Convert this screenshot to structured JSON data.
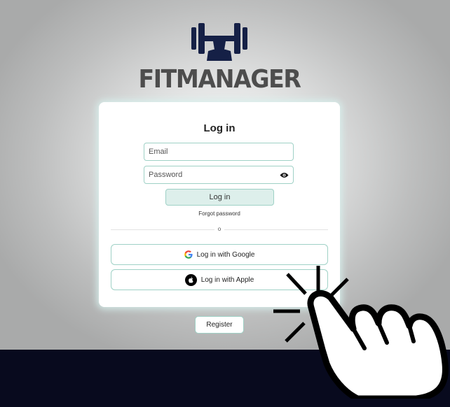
{
  "brand": {
    "name": "FITMANAGER"
  },
  "login_card": {
    "title": "Log in",
    "email_placeholder": "Email",
    "password_placeholder": "Password",
    "login_button": "Log in",
    "forgot_password": "Forgot password",
    "divider_text": "o",
    "google_button": "Log in with Google",
    "apple_button": "Log in with Apple"
  },
  "register_button": "Register",
  "icons": {
    "logo": "dumbbell-bench-icon",
    "show_password": "eye-icon",
    "google": "google-icon",
    "apple": "apple-icon",
    "pointer": "tap-hand-icon"
  },
  "colors": {
    "brand_navy": "#152046",
    "brand_text": "#4d4d4d",
    "accent_border": "#9fd1c6",
    "primary_button_bg": "#ddefeb",
    "footer_band": "#080a1e"
  }
}
